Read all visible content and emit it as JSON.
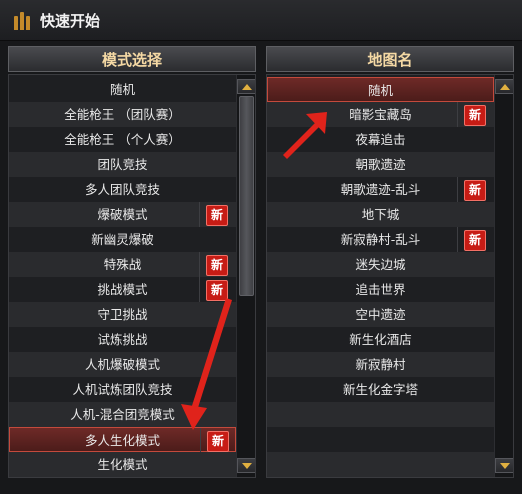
{
  "window": {
    "title": "快速开始",
    "icon": "menu-bars-icon"
  },
  "left_panel": {
    "header": "模式选择",
    "items": [
      {
        "label": "随机",
        "badge": ""
      },
      {
        "label": "全能枪王 （团队赛）",
        "badge": ""
      },
      {
        "label": "全能枪王 （个人赛）",
        "badge": ""
      },
      {
        "label": "团队竞技",
        "badge": ""
      },
      {
        "label": "多人团队竞技",
        "badge": ""
      },
      {
        "label": "爆破模式",
        "badge": "新"
      },
      {
        "label": "新幽灵爆破",
        "badge": ""
      },
      {
        "label": "特殊战",
        "badge": "新"
      },
      {
        "label": "挑战模式",
        "badge": "新"
      },
      {
        "label": "守卫挑战",
        "badge": ""
      },
      {
        "label": "试炼挑战",
        "badge": ""
      },
      {
        "label": "人机爆破模式",
        "badge": ""
      },
      {
        "label": "人机试炼团队竞技",
        "badge": ""
      },
      {
        "label": "人机-混合团竞模式",
        "badge": ""
      },
      {
        "label": "多人生化模式",
        "badge": "新",
        "selected": true
      },
      {
        "label": "生化模式",
        "badge": ""
      }
    ]
  },
  "right_panel": {
    "header": "地图名",
    "items": [
      {
        "label": "随机",
        "badge": "",
        "selected": true
      },
      {
        "label": "暗影宝藏岛",
        "badge": "新"
      },
      {
        "label": "夜幕追击",
        "badge": ""
      },
      {
        "label": "朝歌遗迹",
        "badge": ""
      },
      {
        "label": "朝歌遗迹-乱斗",
        "badge": "新"
      },
      {
        "label": "地下城",
        "badge": ""
      },
      {
        "label": "新寂静村-乱斗",
        "badge": "新"
      },
      {
        "label": "迷失边城",
        "badge": ""
      },
      {
        "label": "追击世界",
        "badge": ""
      },
      {
        "label": "空中遗迹",
        "badge": ""
      },
      {
        "label": "新生化酒店",
        "badge": ""
      },
      {
        "label": "新寂静村",
        "badge": ""
      },
      {
        "label": "新生化金字塔",
        "badge": ""
      },
      {
        "label": "",
        "badge": ""
      },
      {
        "label": "",
        "badge": ""
      },
      {
        "label": "",
        "badge": ""
      }
    ]
  },
  "colors": {
    "badge": "#c71c15",
    "selected": "#6e2a27",
    "header_text": "#f5d9a4",
    "annotation_arrow": "#e0231b"
  }
}
